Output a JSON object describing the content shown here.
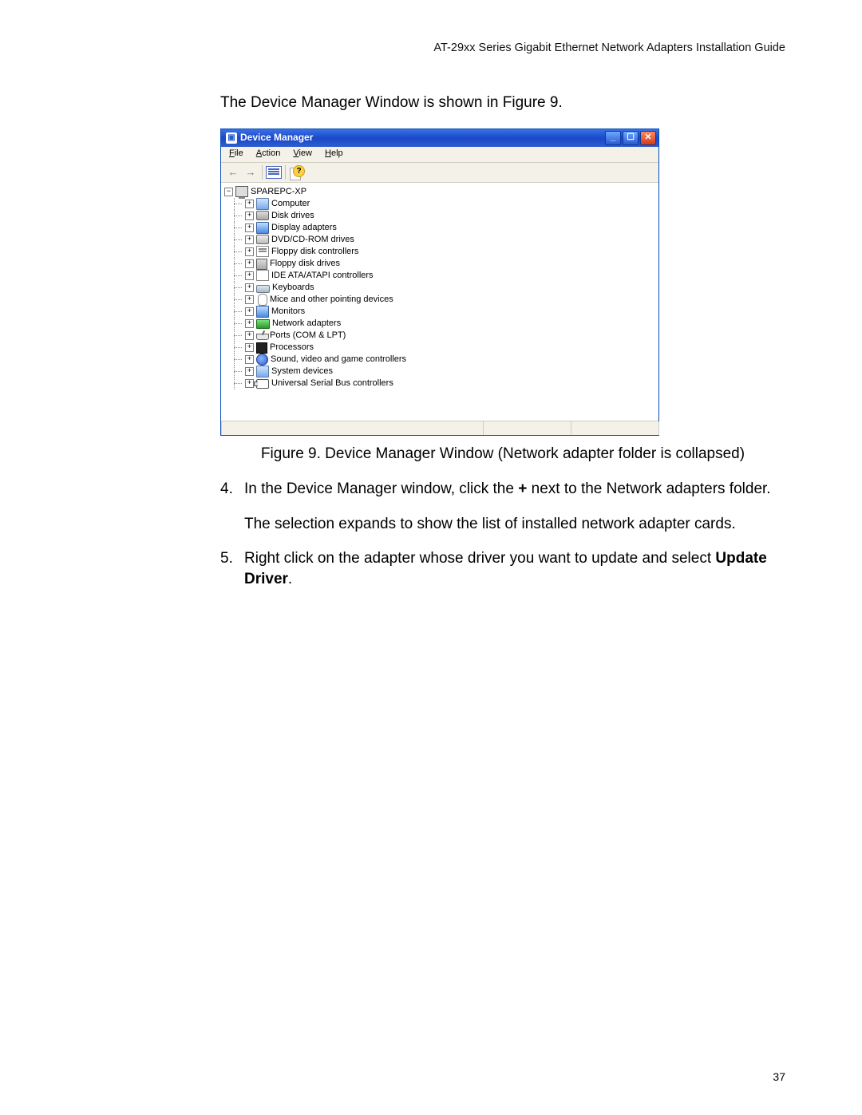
{
  "running_head": "AT-29xx Series Gigabit Ethernet Network Adapters Installation Guide",
  "intro_text": "The Device Manager Window is shown in Figure 9.",
  "figure_caption": "Figure 9. Device Manager Window (Network adapter folder is collapsed)",
  "steps": [
    {
      "num": "4.",
      "text_a": "In the Device Manager window, click the ",
      "bold_a": "+",
      "text_b": " next to the Network adapters folder.",
      "sub": "The selection expands to show the list of installed network adapter cards."
    },
    {
      "num": "5.",
      "text_a": "Right click on the adapter whose driver you want to update and select ",
      "bold_a": "Update Driver",
      "text_b": "."
    }
  ],
  "page_number": "37",
  "window": {
    "title": "Device Manager",
    "menu": {
      "file": "File",
      "action": "Action",
      "view": "View",
      "help": "Help"
    },
    "root_label": "SPAREPC-XP",
    "root_expander": "−",
    "item_expander": "+",
    "items": [
      {
        "icon": "computer",
        "label": "Computer"
      },
      {
        "icon": "disk",
        "label": "Disk drives"
      },
      {
        "icon": "display",
        "label": "Display adapters"
      },
      {
        "icon": "dvd",
        "label": "DVD/CD-ROM drives"
      },
      {
        "icon": "floppyctl",
        "label": "Floppy disk controllers"
      },
      {
        "icon": "floppy",
        "label": "Floppy disk drives"
      },
      {
        "icon": "ide",
        "label": "IDE ATA/ATAPI controllers"
      },
      {
        "icon": "keyboard",
        "label": "Keyboards"
      },
      {
        "icon": "mouse",
        "label": "Mice and other pointing devices"
      },
      {
        "icon": "monitor",
        "label": "Monitors"
      },
      {
        "icon": "network",
        "label": "Network adapters"
      },
      {
        "icon": "ports",
        "label": "Ports (COM & LPT)"
      },
      {
        "icon": "cpu",
        "label": "Processors"
      },
      {
        "icon": "sound",
        "label": "Sound, video and game controllers"
      },
      {
        "icon": "system",
        "label": "System devices"
      },
      {
        "icon": "usb",
        "label": "Universal Serial Bus controllers"
      }
    ]
  }
}
